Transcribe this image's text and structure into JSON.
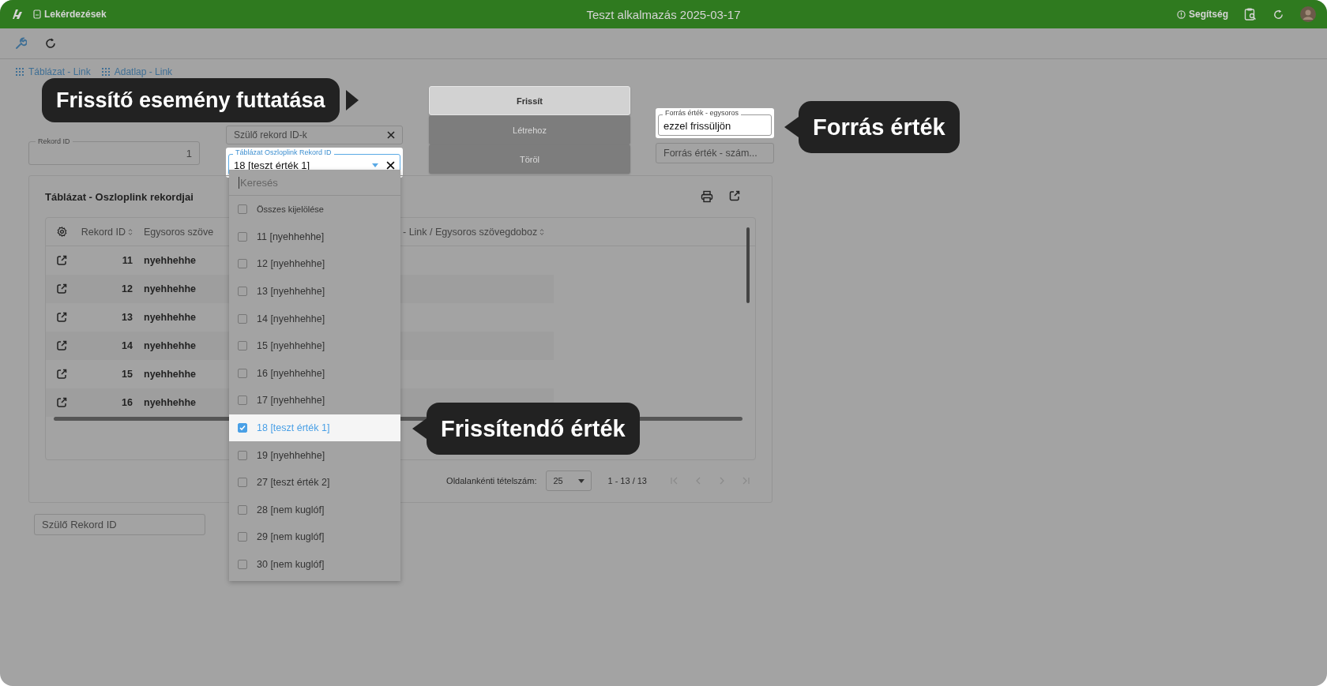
{
  "app_bar": {
    "section": "Lekérdezések",
    "title": "Teszt alkalmazás 2025-03-17",
    "help": "Segítség"
  },
  "breadcrumb": [
    {
      "label": "Táblázat - Link"
    },
    {
      "label": "Adatlap - Link"
    }
  ],
  "buttons": [
    {
      "label": "Frissít",
      "highlighted": true
    },
    {
      "label": "Létrehoz",
      "highlighted": false
    },
    {
      "label": "Töröl",
      "highlighted": false
    }
  ],
  "fields": {
    "record_id": {
      "label": "Rekord ID",
      "value": "1",
      "highlighted": false
    },
    "parent_ids": {
      "placeholder": "Szülő rekord ID-k",
      "highlighted": false
    },
    "lookup": {
      "label": "Táblázat Oszloplink Rekord ID",
      "value": "18 [teszt érték 1]",
      "highlighted": true,
      "search_placeholder": "Keresés",
      "select_all": "Összes kijelölése",
      "select_all_checked": false,
      "options": [
        {
          "label": "11 [nyehhehhe]",
          "selected": false
        },
        {
          "label": "12 [nyehhehhe]",
          "selected": false
        },
        {
          "label": "13 [nyehhehhe]",
          "selected": false
        },
        {
          "label": "14 [nyehhehhe]",
          "selected": false
        },
        {
          "label": "15 [nyehhehhe]",
          "selected": false
        },
        {
          "label": "16 [nyehhehhe]",
          "selected": false
        },
        {
          "label": "17 [nyehhehhe]",
          "selected": false
        },
        {
          "label": "18 [teszt érték 1]",
          "selected": true
        },
        {
          "label": "19 [nyehhehhe]",
          "selected": false
        },
        {
          "label": "27 [teszt érték 2]",
          "selected": false
        },
        {
          "label": "28 [nem kuglóf]",
          "selected": false
        },
        {
          "label": "29 [nem kuglóf]",
          "selected": false
        },
        {
          "label": "30 [nem kuglóf]",
          "selected": false
        }
      ]
    },
    "source_text": {
      "label": "Forrás érték - egysoros",
      "value": "ezzel frissüljön",
      "highlighted": true
    },
    "source_number": {
      "placeholder": "Forrás érték - szám...",
      "highlighted": false
    },
    "parent_record": {
      "placeholder": "Szülő Rekord ID",
      "highlighted": false
    }
  },
  "table": {
    "title": "Táblázat - Oszloplink rekordjai",
    "columns": [
      "Rekord ID",
      "Egysoros szöve",
      "- Link / Egysoros szövegdoboz"
    ],
    "rows": [
      {
        "id": "11",
        "text": "nyehhehhe"
      },
      {
        "id": "12",
        "text": "nyehhehhe"
      },
      {
        "id": "13",
        "text": "nyehhehhe"
      },
      {
        "id": "14",
        "text": "nyehhehhe"
      },
      {
        "id": "15",
        "text": "nyehhehhe"
      },
      {
        "id": "16",
        "text": "nyehhehhe"
      }
    ],
    "page_size_label": "Oldalankénti tételszám:",
    "page_size": "25",
    "range": "1 - 13 / 13"
  },
  "callouts": [
    {
      "text": "Frissítő esemény futtatása"
    },
    {
      "text": "Forrás érték"
    },
    {
      "text": "Frissítendő érték"
    }
  ]
}
